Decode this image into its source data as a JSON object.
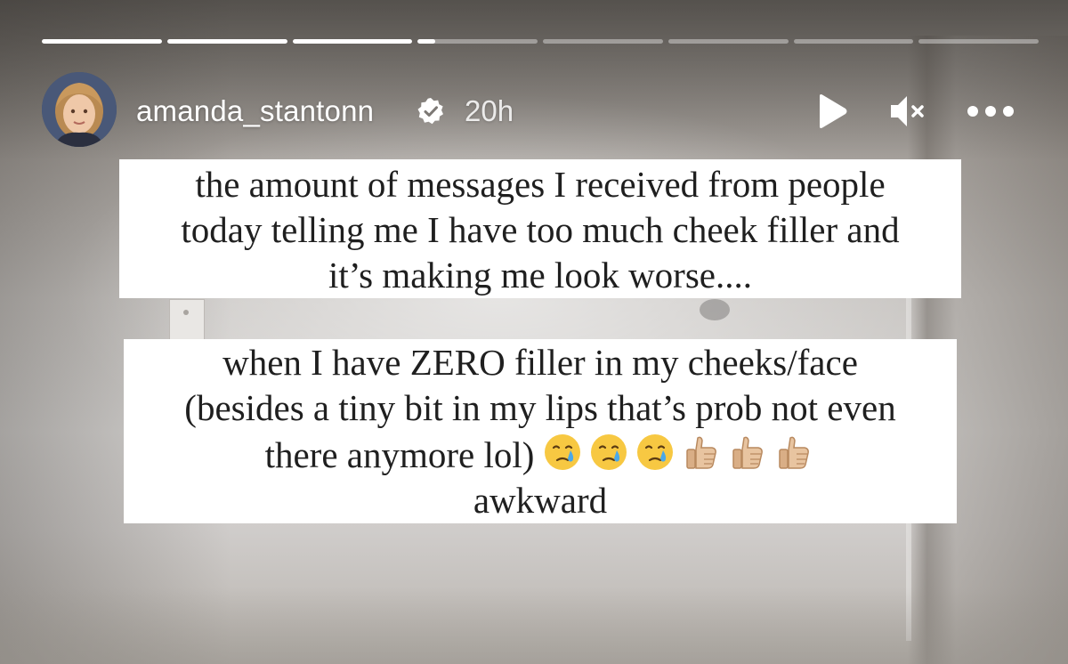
{
  "story": {
    "progress_segments": [
      1,
      1,
      1,
      0.15,
      0,
      0,
      0,
      0
    ]
  },
  "header": {
    "username": "amanda_stantonn",
    "time_ago": "20h",
    "verified_icon": "verified-badge-icon",
    "controls": {
      "play_icon": "play-icon",
      "mute_icon": "mute-icon",
      "more_icon": "more-options-icon"
    }
  },
  "stickers": {
    "first": {
      "lines": [
        "the amount of messages I received from people",
        "today telling me I have too much cheek filler and",
        "it’s making me look worse...."
      ]
    },
    "second": {
      "lines": [
        "when I have ZERO filler in my cheeks/face",
        "(besides a tiny bit in my lips that’s prob not even",
        "there anymore lol)",
        "awkward"
      ],
      "emojis": [
        "crying-face-icon",
        "crying-face-icon",
        "crying-face-icon",
        "thumbs-up-icon",
        "thumbs-up-icon",
        "thumbs-up-icon"
      ]
    }
  },
  "colors": {
    "sticker_bg": "#ffffff",
    "text": "#1f1f1f",
    "header_text": "#ffffff"
  }
}
